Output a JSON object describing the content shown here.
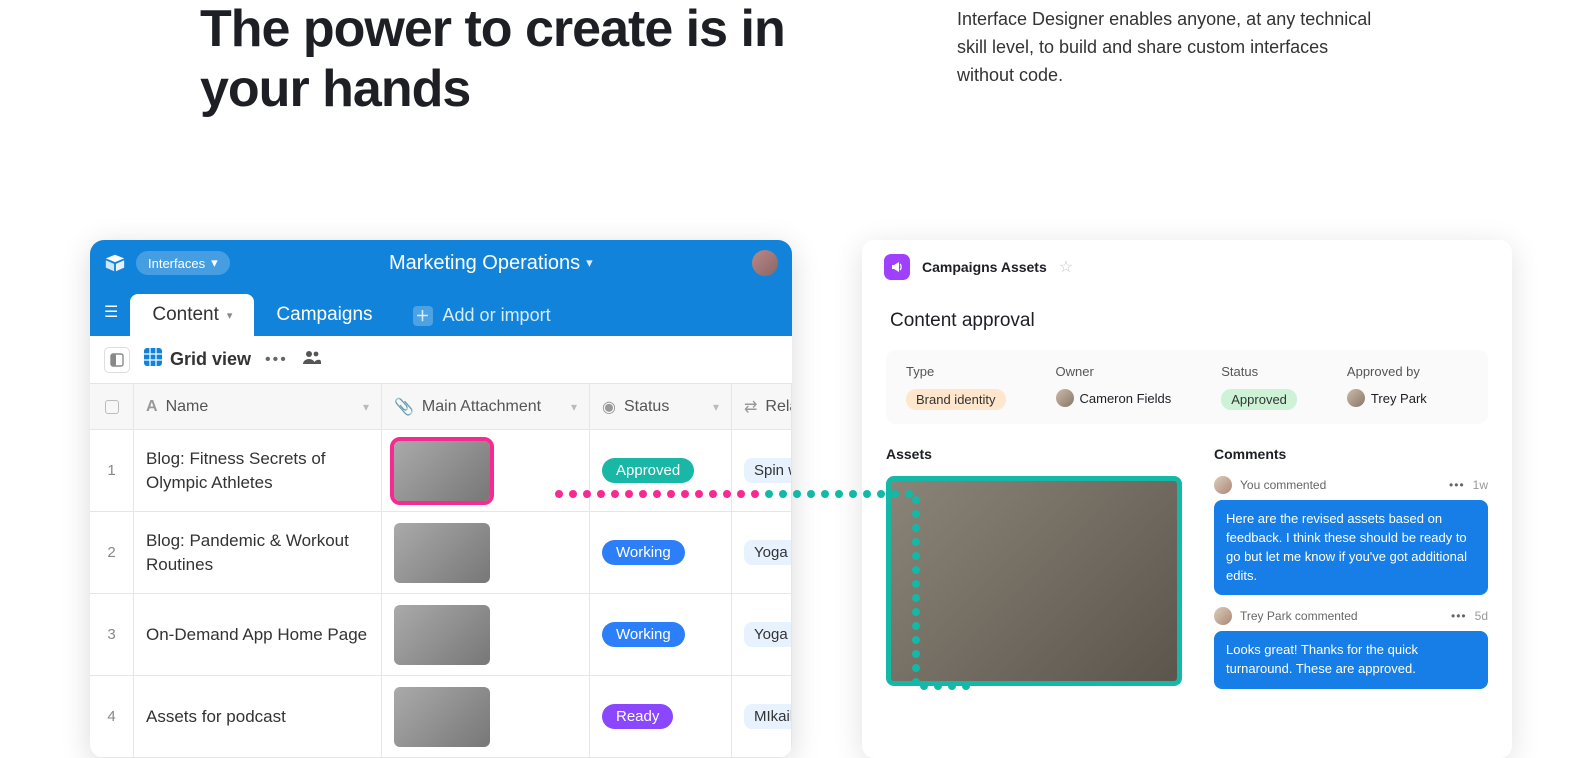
{
  "hero": {
    "headline": "The power to create is in your hands",
    "subtext": "Interface Designer enables anyone, at any technical skill level, to build and share custom interfaces without code."
  },
  "left": {
    "interfaces_chip": "Interfaces",
    "workspace_title": "Marketing Operations",
    "tabs": {
      "content": "Content",
      "campaigns": "Campaigns",
      "add_import": "Add or import"
    },
    "view": {
      "grid_view": "Grid view"
    },
    "columns": {
      "name": "Name",
      "attachment": "Main Attachment",
      "status": "Status",
      "related": "Relat"
    },
    "rows": [
      {
        "num": "1",
        "name": "Blog: Fitness Secrets of Olympic Athletes",
        "status": "Approved",
        "status_class": "pill-approved",
        "rel": "Spin w",
        "selected": true
      },
      {
        "num": "2",
        "name": "Blog: Pandemic & Workout Routines",
        "status": "Working",
        "status_class": "pill-working",
        "rel": "Yoga "
      },
      {
        "num": "3",
        "name": "On-Demand App Home Page",
        "status": "Working",
        "status_class": "pill-working",
        "rel": "Yoga "
      },
      {
        "num": "4",
        "name": "Assets for podcast",
        "status": "Ready",
        "status_class": "pill-ready",
        "rel": "MIkail"
      }
    ]
  },
  "right": {
    "breadcrumb": "Campaigns Assets",
    "subtitle": "Content approval",
    "meta": {
      "type_label": "Type",
      "type_value": "Brand identity",
      "owner_label": "Owner",
      "owner_value": "Cameron Fields",
      "status_label": "Status",
      "status_value": "Approved",
      "approvedby_label": "Approved by",
      "approvedby_value": "Trey Park"
    },
    "assets_heading": "Assets",
    "comments_heading": "Comments",
    "comments": [
      {
        "author": "You commented",
        "age": "1w",
        "body": "Here are the revised assets based on feedback. I think these should be ready to go but let me know if you've got additional edits."
      },
      {
        "author": "Trey Park commented",
        "age": "5d",
        "body": "Looks great! Thanks for the quick turnaround. These are approved."
      }
    ]
  }
}
